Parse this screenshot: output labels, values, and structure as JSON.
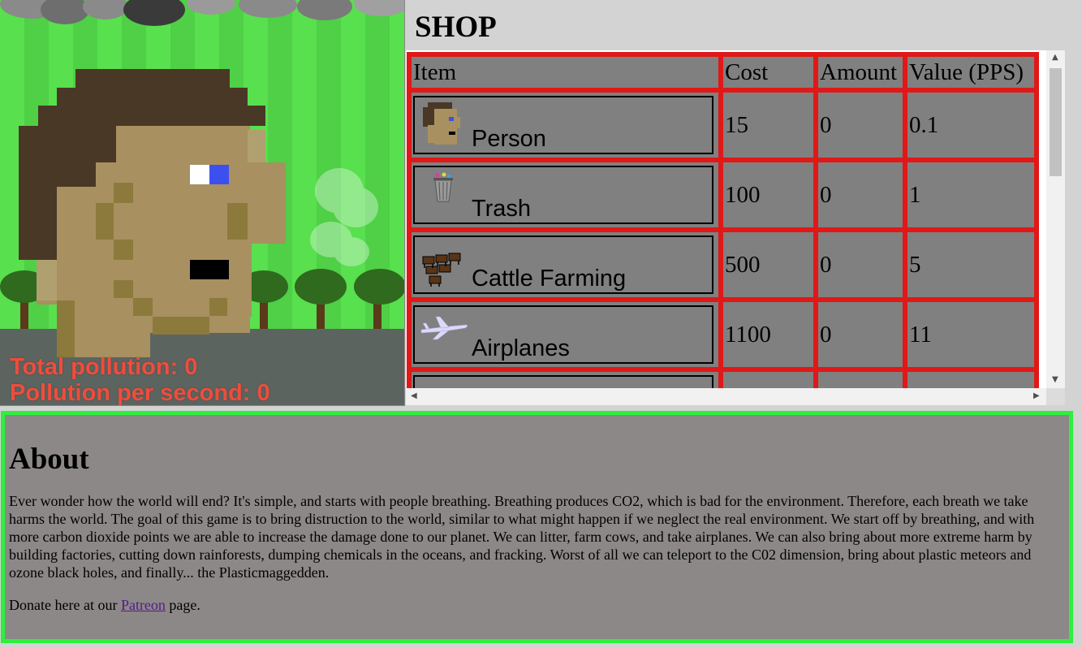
{
  "game": {
    "stats": {
      "total_label": "Total pollution: ",
      "total_value": "0",
      "pps_label": "Pollution per second: ",
      "pps_value": "0"
    },
    "character": "pixel-person-head-icon",
    "colors": {
      "sky": "#58e04e",
      "stripe": "#4fd046",
      "ground": "#5c6460",
      "stat_text": "#f04c3c",
      "skin": "#a89060",
      "hair": "#4a3826"
    }
  },
  "shop": {
    "title": "SHOP",
    "columns": [
      "Item",
      "Cost",
      "Amount",
      "Value (PPS)"
    ],
    "items": [
      {
        "name": "Person",
        "icon": "person-head-icon",
        "cost": "15",
        "amount": "0",
        "value": "0.1"
      },
      {
        "name": "Trash",
        "icon": "trash-can-icon",
        "cost": "100",
        "amount": "0",
        "value": "1"
      },
      {
        "name": "Cattle Farming",
        "icon": "cattle-icon",
        "cost": "500",
        "amount": "0",
        "value": "5"
      },
      {
        "name": "Airplanes",
        "icon": "airplane-icon",
        "cost": "1100",
        "amount": "0",
        "value": "11"
      }
    ],
    "colors": {
      "border": "#e01818",
      "cell": "#808080"
    }
  },
  "about": {
    "title": "About",
    "body": "Ever wonder how the world will end? It's simple, and starts with people breathing. Breathing produces CO2, which is bad for the environment. Therefore, each breath we take harms the world. The goal of this game is to bring distruction to the world, similar to what might happen if we neglect the real environment. We start off by breathing, and with more carbon dioxide points we are able to increase the damage done to our planet. We can litter, farm cows, and take airplanes. We can also bring about more extreme harm by building factories, cutting down rainforests, dumping chemicals in the oceans, and fracking. Worst of all we can teleport to the C02 dimension, bring about plastic meteors and ozone black holes, and finally... the Plasticmaggedden.",
    "donate_prefix": "Donate here at our ",
    "donate_link": "Patreon",
    "donate_suffix": " page.",
    "colors": {
      "background": "#8c8888",
      "border": "#2cf03c",
      "link": "#551a8b"
    }
  }
}
